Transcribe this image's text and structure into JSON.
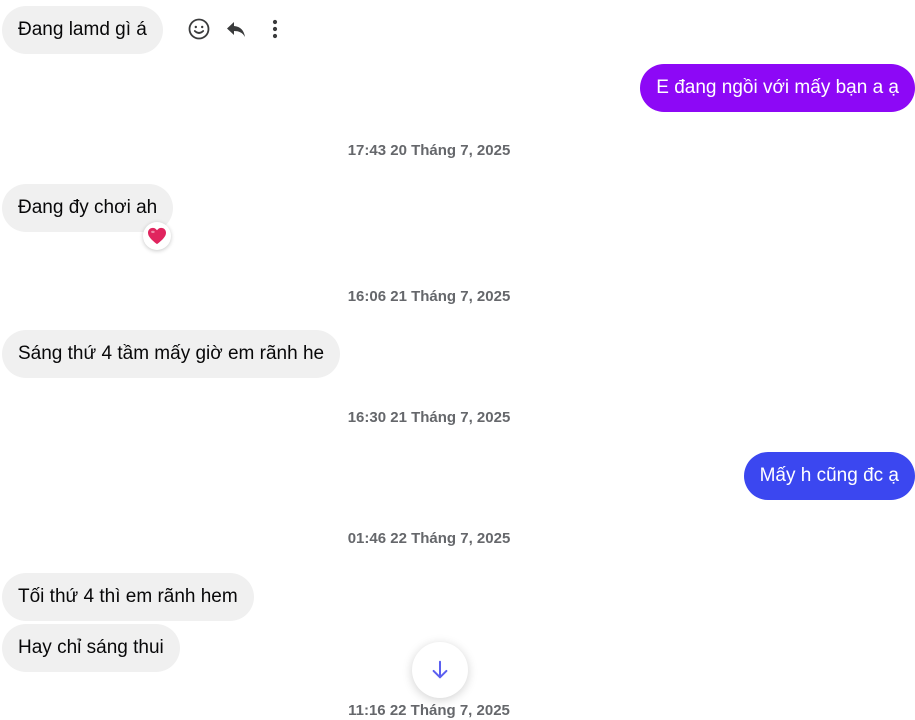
{
  "colors": {
    "incoming_bubble": "#f0f0f0",
    "outgoing_purple": "#8d08f6",
    "outgoing_blue": "#3b47f0",
    "timestamp_text": "#65676b",
    "icon": "#3a3b3c",
    "reaction_heart": "#e0245e",
    "scroll_arrow": "#5b5ff0"
  },
  "toolbar": {
    "react_icon": "smiley-icon",
    "reply_icon": "reply-icon",
    "more_icon": "more-vertical-icon"
  },
  "messages": [
    {
      "direction": "incoming",
      "text": "Đang lamd gì á"
    },
    {
      "direction": "outgoing",
      "text": "E đang ngồi với mấy bạn a ạ"
    },
    {
      "type": "timestamp",
      "text": "17:43 20 Tháng 7, 2025"
    },
    {
      "direction": "incoming",
      "text": "Đang đy chơi ah",
      "reaction": "❤️"
    },
    {
      "type": "timestamp",
      "text": "16:06 21 Tháng 7, 2025"
    },
    {
      "direction": "incoming",
      "text": "Sáng thứ 4 tầm mấy giờ em rãnh he"
    },
    {
      "type": "timestamp",
      "text": "16:30 21 Tháng 7, 2025"
    },
    {
      "direction": "outgoing",
      "text": "Mấy h cũng đc ạ"
    },
    {
      "type": "timestamp",
      "text": "01:46 22 Tháng 7, 2025"
    },
    {
      "direction": "incoming",
      "text": "Tối thứ 4 thì em rãnh hem"
    },
    {
      "direction": "incoming",
      "text": "Hay chỉ sáng thui"
    },
    {
      "type": "timestamp",
      "text": "11:16 22 Tháng 7, 2025"
    }
  ],
  "scroll_button_icon": "arrow-down-icon"
}
